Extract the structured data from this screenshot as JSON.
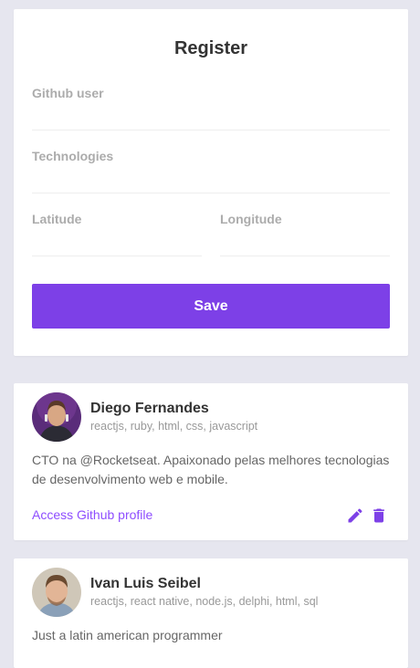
{
  "register": {
    "title": "Register",
    "github_user_label": "Github user",
    "technologies_label": "Technologies",
    "latitude_label": "Latitude",
    "longitude_label": "Longitude",
    "save_label": "Save"
  },
  "devs": [
    {
      "name": "Diego Fernandes",
      "techs": "reactjs, ruby, html, css, javascript",
      "bio": "CTO na @Rocketseat. Apaixonado pelas melhores tecnologias de desenvolvimento web e mobile.",
      "link": "Access Github profile"
    },
    {
      "name": "Ivan Luis Seibel",
      "techs": "reactjs, react native, node.js, delphi, html, sql",
      "bio": "Just a latin american programmer"
    }
  ],
  "colors": {
    "accent": "#7d40e7",
    "link": "#8e4dff",
    "background": "#e6e6ef"
  },
  "icons": [
    "edit-icon",
    "trash-icon"
  ]
}
